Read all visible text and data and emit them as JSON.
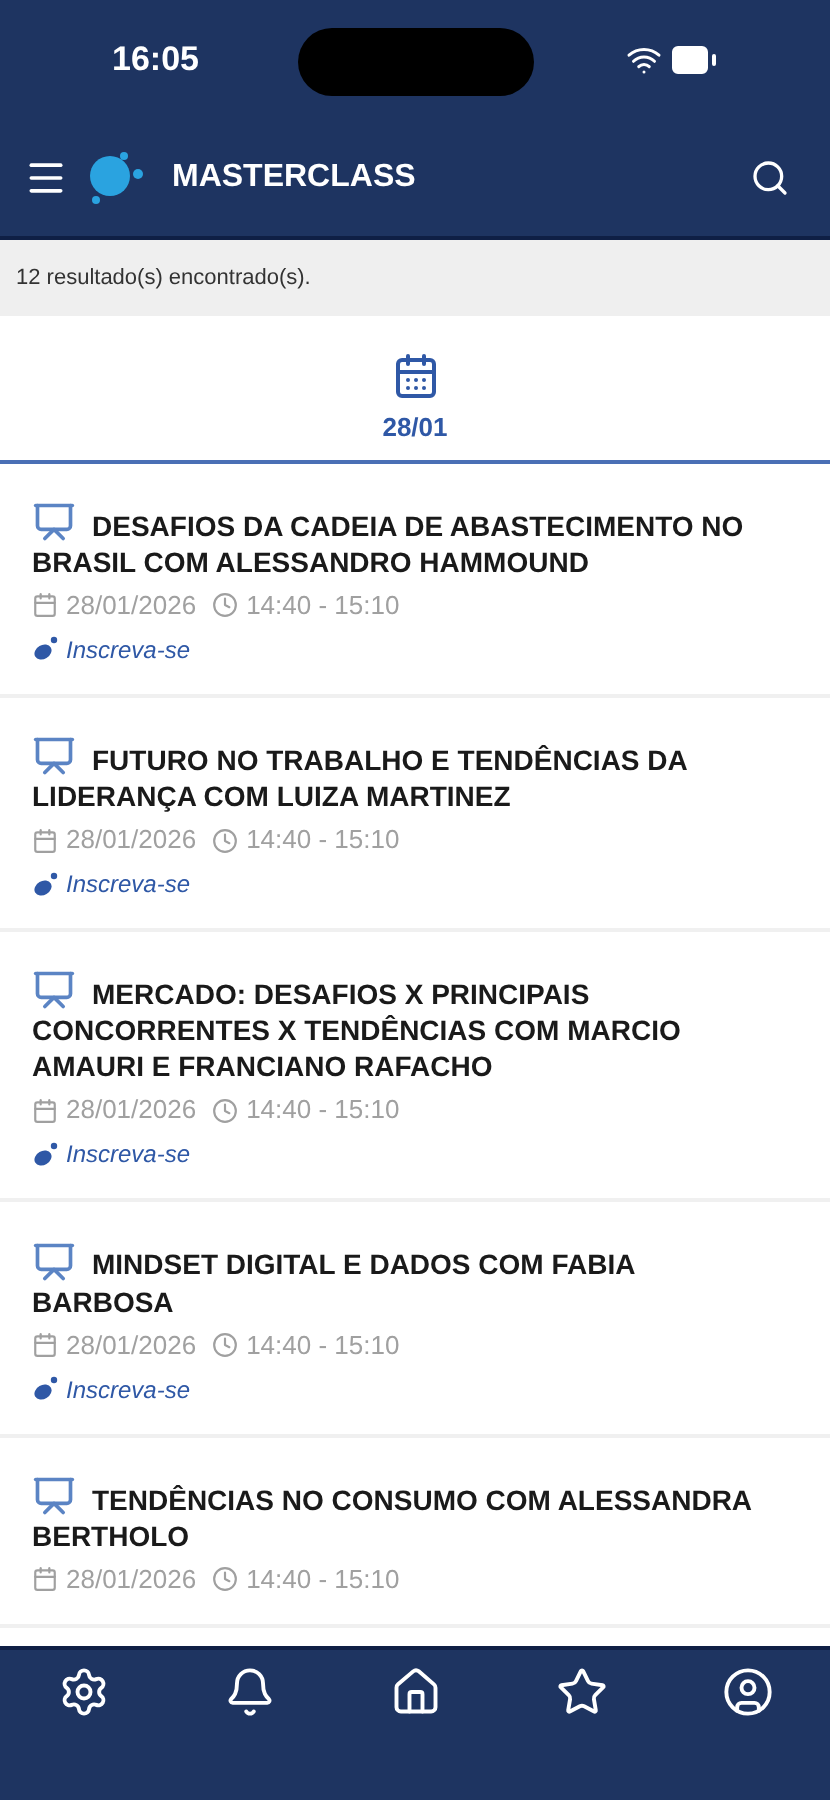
{
  "status_bar": {
    "time": "16:05"
  },
  "app_bar": {
    "title": "MASTERCLASS"
  },
  "results": "12 resultado(s) encontrado(s).",
  "date_tabs": [
    {
      "label": "28/01",
      "selected": true
    }
  ],
  "sessions": [
    {
      "title": "DESAFIOS DA CADEIA DE ABASTECIMENTO NO BRASIL COM ALESSANDRO HAMMOUND",
      "date": "28/01/2026",
      "time": "14:40 - 15:10",
      "link": "Inscreva-se"
    },
    {
      "title": "FUTURO NO TRABALHO E TENDÊNCIAS DA LIDERANÇA COM LUIZA MARTINEZ",
      "date": "28/01/2026",
      "time": "14:40 - 15:10",
      "link": "Inscreva-se"
    },
    {
      "title": "MERCADO: DESAFIOS X PRINCIPAIS CONCORRENTES X TENDÊNCIAS COM MARCIO AMAURI E FRANCIANO RAFACHO",
      "date": "28/01/2026",
      "time": "14:40 - 15:10",
      "link": "Inscreva-se"
    },
    {
      "title": "MINDSET DIGITAL E DADOS COM FABIA BARBOSA",
      "date": "28/01/2026",
      "time": "14:40 - 15:10",
      "link": "Inscreva-se"
    },
    {
      "title": "TENDÊNCIAS NO CONSUMO COM ALESSANDRA BERTHOLO",
      "date": "28/01/2026",
      "time": "14:40 - 15:10"
    }
  ],
  "bottom_nav": [
    {
      "kind": "settings"
    },
    {
      "kind": "notifications"
    },
    {
      "kind": "home"
    },
    {
      "kind": "favorites"
    },
    {
      "kind": "profile"
    }
  ]
}
